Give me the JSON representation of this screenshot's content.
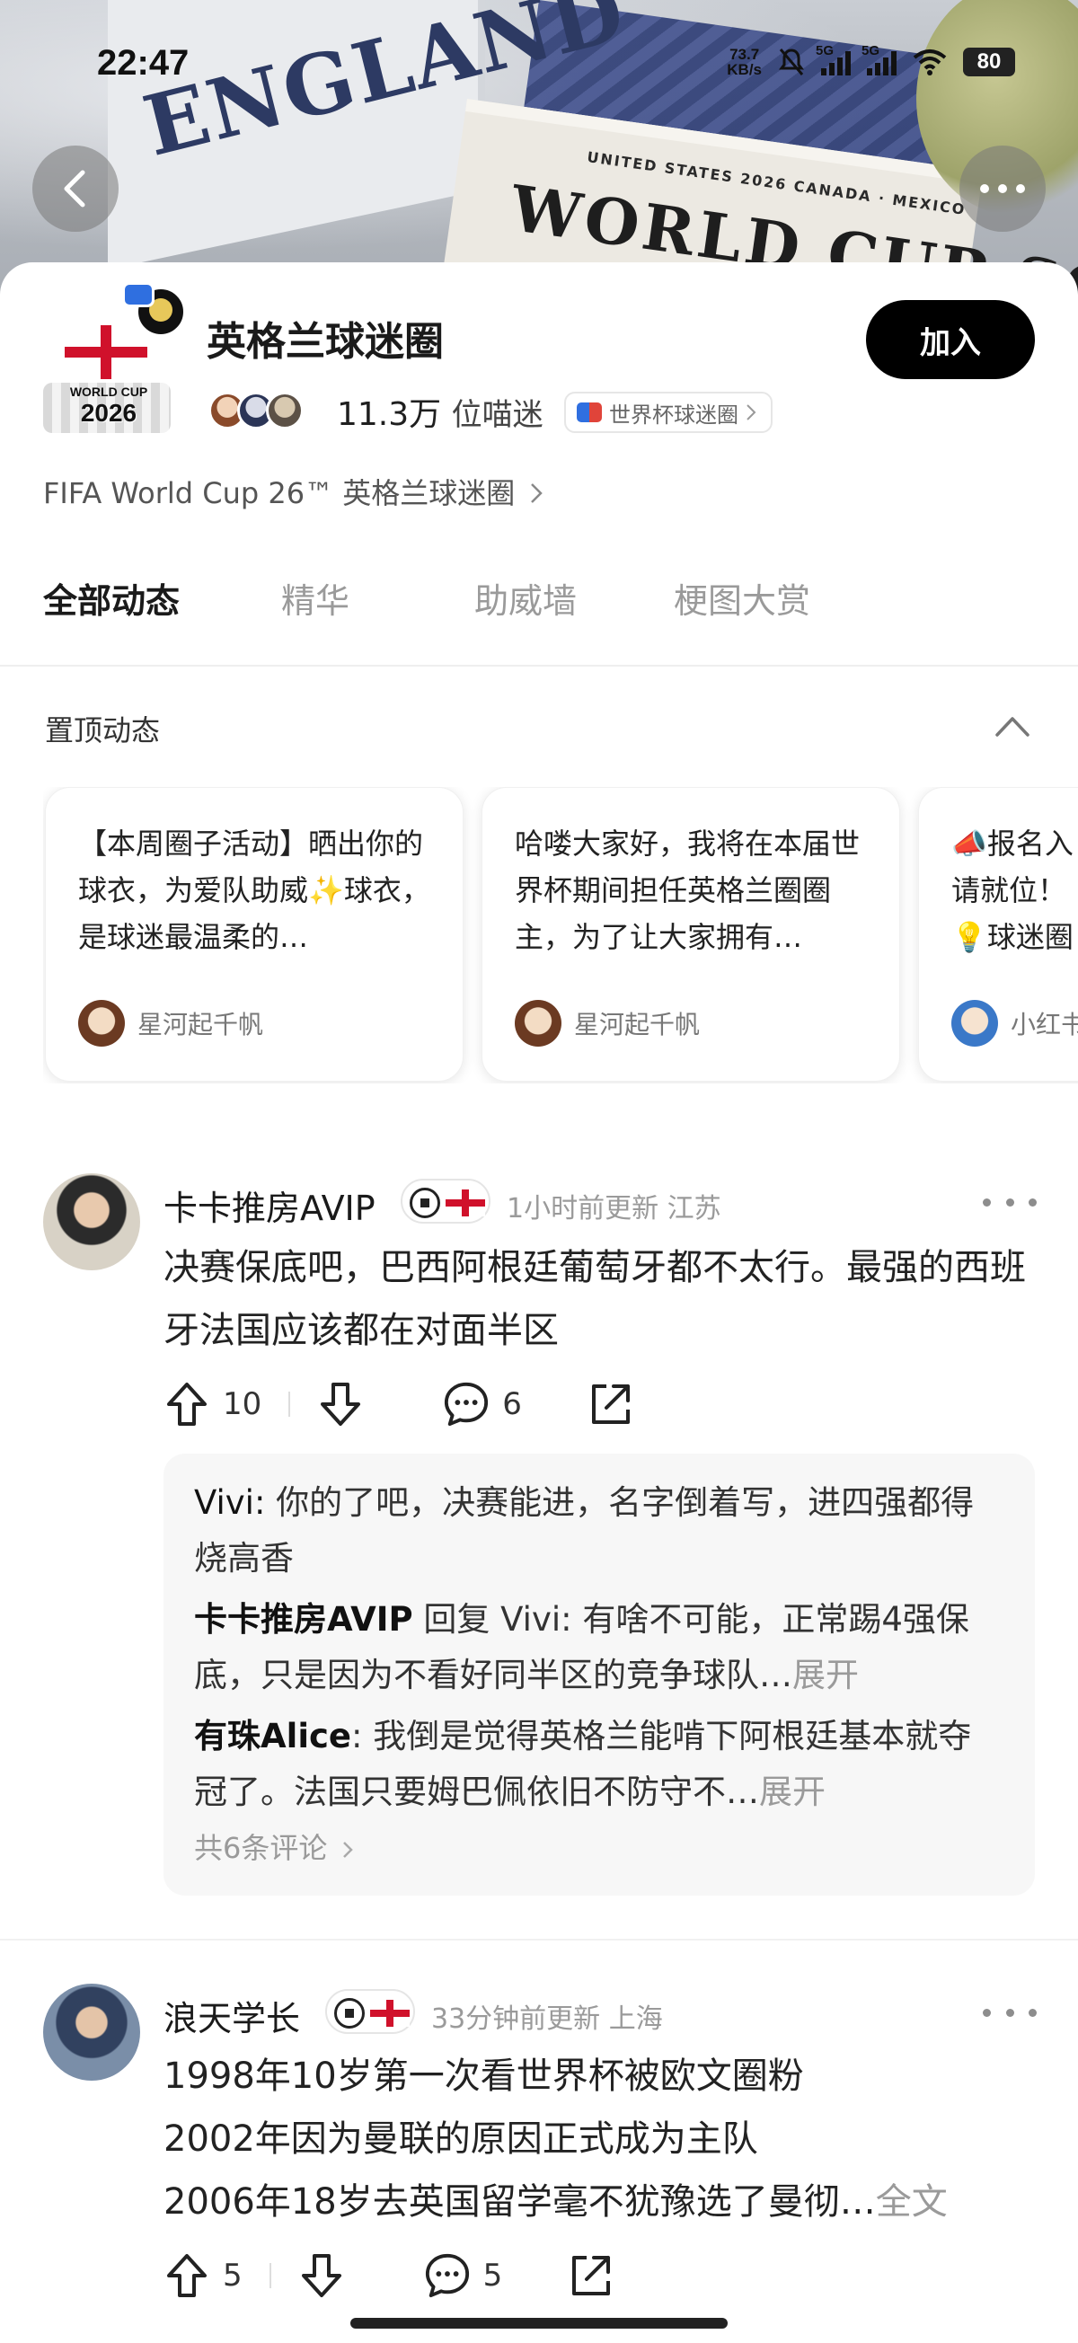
{
  "status": {
    "time": "22:47",
    "net_speed_value": "73.7",
    "net_speed_unit": "KB/s",
    "signal1_label": "5G",
    "signal2_label": "5G",
    "wifi_label": "6",
    "battery": "80"
  },
  "hero": {
    "banner_text": "ENGLAND",
    "board_small": "UNITED STATES   2026   CANADA · MEXICO",
    "board_big": "WORLD CUP SQUAD"
  },
  "circle": {
    "name": "英格兰球迷圈",
    "logo_wc": "WORLD CUP",
    "logo_year": "2026",
    "join_label": "加入",
    "member_count": "11.3万",
    "member_unit": "位喵迷",
    "parent_tag": "世界杯球迷圈",
    "official_link": "FIFA World Cup 26™ 英格兰球迷圈"
  },
  "tabs": [
    {
      "label": "全部动态",
      "active": true
    },
    {
      "label": "精华",
      "active": false
    },
    {
      "label": "助威墙",
      "active": false
    },
    {
      "label": "梗图大赏",
      "active": false
    }
  ],
  "pinned": {
    "title": "置顶动态",
    "cards": [
      {
        "text": "【本周圈子活动】晒出你的球衣，为爱队助威✨球衣，是球迷最温柔的…",
        "author": "星河起千帆"
      },
      {
        "text": "哈喽大家好，我将在本届世界杯期间担任英格兰圈圈主，为了让大家拥有…",
        "author": "星河起千帆"
      },
      {
        "text": "📣报名入请就位！💡球迷圈",
        "author": "小红书"
      }
    ]
  },
  "posts": [
    {
      "author": "卡卡推房AVIP",
      "time": "1小时前更新",
      "location": "江苏",
      "body": "决赛保底吧，巴西阿根廷葡萄牙都不太行。最强的西班牙法国应该都在对面半区",
      "likes": "10",
      "comments": "6",
      "replies": [
        {
          "user": "Vivi:",
          "text": " 你的了吧，决赛能进，名字倒着写，进四强都得烧高香",
          "more": ""
        },
        {
          "user": "卡卡推房AVIP",
          "text": " 回复 Vivi: 有啥不可能，正常踢4强保底，只是因为不看好同半区的竞争球队…",
          "more": "展开"
        },
        {
          "user": "有珠Alice",
          "text": ": 我倒是觉得英格兰能啃下阿根廷基本就夺冠了。法国只要姆巴佩依旧不防守不…",
          "more": "展开"
        }
      ],
      "total_comments": "共6条评论"
    },
    {
      "author": "浪天学长",
      "time": "33分钟前更新",
      "location": "上海",
      "body_lines": [
        "1998年10岁第一次看世界杯被欧文圈粉",
        "2002年因为曼联的原因正式成为主队",
        "2006年18岁去英国留学毫不犹豫选了曼彻…"
      ],
      "full_text": "全文",
      "likes": "5",
      "comments": "5"
    }
  ],
  "colors": {
    "accent_black": "#000000",
    "england_red": "#d0112b",
    "muted_text": "#9a9a9a"
  },
  "icons": [
    "back-icon",
    "more-icon",
    "collapse-chevron-icon",
    "upvote-icon",
    "downvote-icon",
    "comment-icon",
    "share-icon"
  ]
}
